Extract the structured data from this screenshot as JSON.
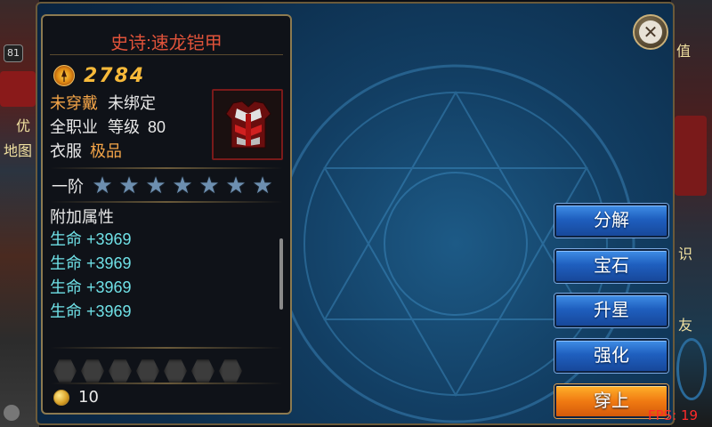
{
  "item": {
    "name": "史诗:速龙铠甲",
    "power": "2784",
    "equip_status": "未穿戴",
    "bind_status": "未绑定",
    "class_req": "全职业",
    "level_label": "等级",
    "level": "80",
    "slot_type": "衣服",
    "quality": "极品"
  },
  "rank": {
    "label": "一阶",
    "star_count": 7
  },
  "attributes": {
    "title": "附加属性",
    "items": [
      {
        "label": "生命",
        "value": "+3969"
      },
      {
        "label": "生命",
        "value": "+3969"
      },
      {
        "label": "生命",
        "value": "+3969"
      },
      {
        "label": "生命",
        "value": "+3969"
      }
    ]
  },
  "gem_slots": 7,
  "cost": {
    "value": "10"
  },
  "buttons": {
    "decompose": "分解",
    "gem": "宝石",
    "star_up": "升星",
    "enhance": "强化",
    "equip": "穿上"
  },
  "fps": "FPS: 19",
  "background": {
    "left_badge": "81",
    "left_text_1": "优",
    "left_text_2": "地图",
    "right_text_1": "值",
    "right_text_2": "识",
    "right_text_3": "友"
  },
  "colors": {
    "title": "#e0533a",
    "power": "#f6b93a",
    "orange_text": "#f3a448",
    "attr_text": "#6fe0e6",
    "button_blue": "#1f5fbf",
    "button_orange": "#f07a12",
    "fps": "#ff2a2a"
  },
  "icons": [
    "power-icon",
    "armor-icon",
    "star-icon",
    "gem-slot-icon",
    "coin-icon",
    "close-icon"
  ]
}
